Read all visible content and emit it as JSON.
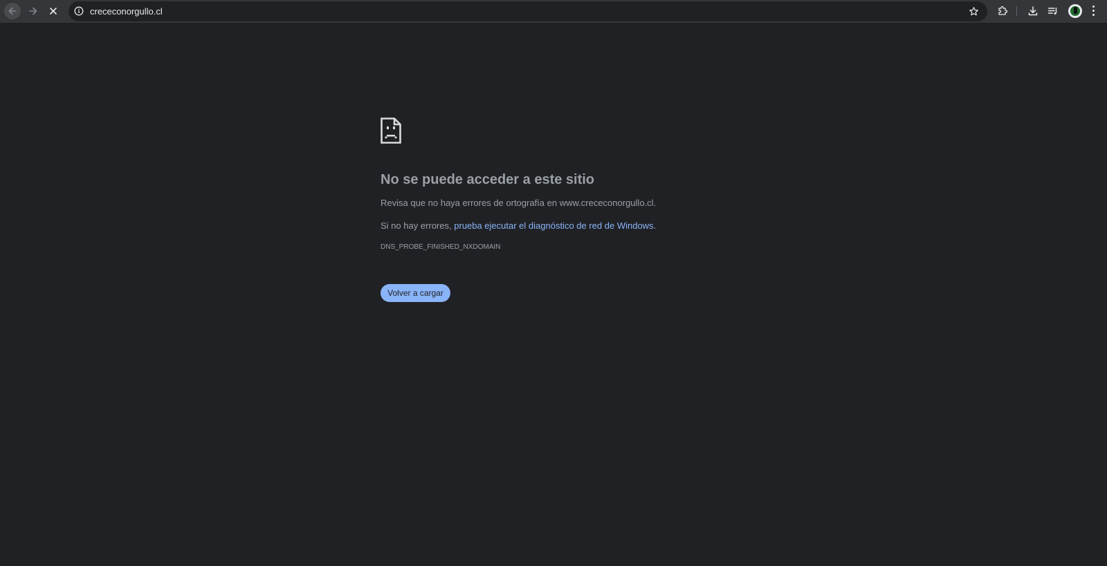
{
  "browser": {
    "url": "crececonorgullo.cl",
    "icons": {
      "back": "arrow-left-icon",
      "forward": "arrow-right-icon",
      "stop": "close-icon",
      "info": "info-icon",
      "bookmark": "star-icon",
      "extensions": "puzzle-icon",
      "downloads": "download-icon",
      "media": "playlist-icon",
      "profile": "avatar",
      "menu": "three-dots-icon"
    }
  },
  "error_page": {
    "icon": "sad-document-icon",
    "title": "No se puede acceder a este sitio",
    "line1": "Revisa que no haya errores de ortografía en www.crececonorgullo.cl.",
    "line2_prefix": "Si no hay errores, ",
    "line2_link": "prueba ejecutar el diagnóstico de red de Windows",
    "line2_suffix": ".",
    "error_code": "DNS_PROBE_FINISHED_NXDOMAIN",
    "reload_label": "Volver a cargar"
  },
  "colors": {
    "page_bg": "#202124",
    "toolbar_bg": "#35363a",
    "text": "#9aa0a6",
    "link": "#8ab4f8",
    "button_bg": "#8ab4f8"
  }
}
